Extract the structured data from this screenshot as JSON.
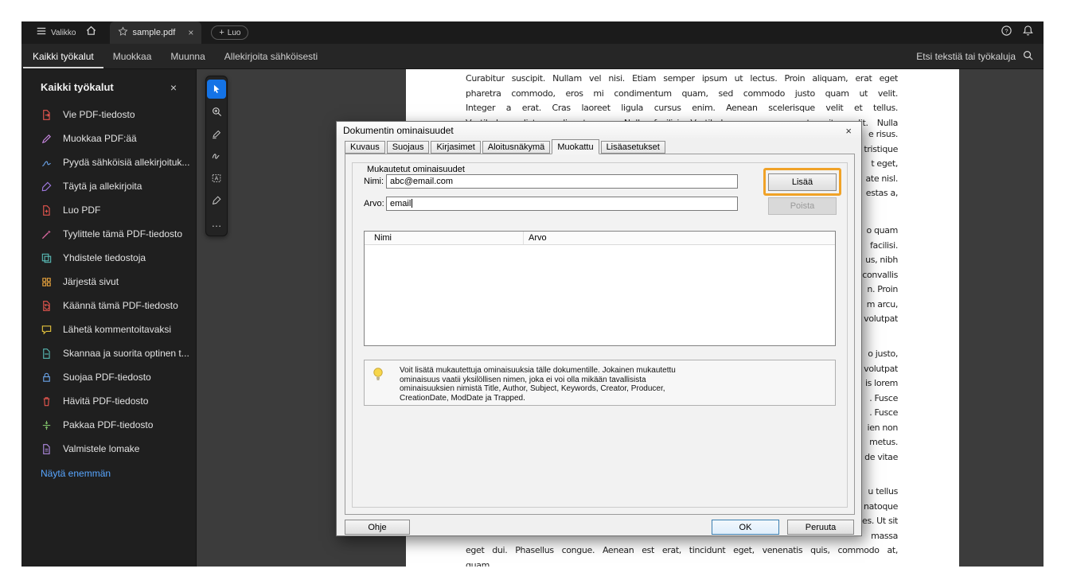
{
  "colors": {
    "accent_blue": "#1473e6",
    "highlight_orange": "#f0a227",
    "link_blue": "#58a6ff"
  },
  "icons": {
    "close": "×",
    "plus": "+",
    "more": "…"
  },
  "topbar": {
    "menu_label": "Valikko",
    "tab_title": "sample.pdf",
    "new_tab_label": "Luo"
  },
  "navbar": {
    "tabs": [
      "Kaikki työkalut",
      "Muokkaa",
      "Muunna",
      "Allekirjoita sähköisesti"
    ],
    "search_label": "Etsi tekstiä tai työkaluja"
  },
  "sidebar": {
    "title": "Kaikki työkalut",
    "show_more_label": "Näytä enemmän",
    "items": [
      "Vie PDF-tiedosto",
      "Muokkaa PDF:ää",
      "Pyydä sähköisiä allekirjoituk...",
      "Täytä ja allekirjoita",
      "Luo PDF",
      "Tyylittele tämä PDF-tiedosto",
      "Yhdistele tiedostoja",
      "Järjestä sivut",
      "Käännä tämä PDF-tiedosto",
      "Lähetä kommentoitavaksi",
      "Skannaa ja suorita optinen t...",
      "Suojaa PDF-tiedosto",
      "Hävitä PDF-tiedosto",
      "Pakkaa PDF-tiedosto",
      "Valmistele lomake"
    ]
  },
  "dialog": {
    "title": "Dokumentin ominaisuudet",
    "tabs": [
      "Kuvaus",
      "Suojaus",
      "Kirjasimet",
      "Aloitusnäkymä",
      "Muokattu",
      "Lisäasetukset"
    ],
    "active_tab": "Muokattu",
    "group_title": "Mukautetut ominaisuudet",
    "name_label": "Nimi:",
    "name_value": "abc@email.com",
    "value_label": "Arvo:",
    "value_value": "email",
    "add_label": "Lisää",
    "remove_label": "Poista",
    "table_headers": [
      "Nimi",
      "Arvo"
    ],
    "info_text": "Voit lisätä mukautettuja ominaisuuksia tälle dokumentille. Jokainen mukautettu ominaisuus vaatii yksilöllisen nimen, joka ei voi olla mikään tavallisista ominaisuuksien nimistä Title, Author, Subject, Keywords, Creator, Producer, CreationDate, ModDate ja Trapped.",
    "help_label": "Ohje",
    "ok_label": "OK",
    "cancel_label": "Peruuta"
  },
  "document": {
    "top_lines": [
      "Curabitur suscipit. Nullam vel nisi. Etiam semper ipsum ut lectus. Proin aliquam, erat eget",
      "pharetra commodo, eros mi condimentum quam, sed commodo justo quam ut velit.",
      "Integer a erat. Cras laoreet ligula cursus enim. Aenean scelerisque velit et tellus.",
      "Vestibulum dictum aliquet sem. Nulla facilisi. Vestibulum accumsan ante vitae elit. Nulla"
    ],
    "fragments_a": [
      "e risus.",
      "tristique",
      "t eget,",
      "ate nisl.",
      "estas a,"
    ],
    "fragments_b": [
      "o quam",
      "facilisi.",
      "us, nibh",
      "convallis",
      "n. Proin",
      "m arcu,",
      "volutpat"
    ],
    "fragments_c": [
      "o justo,",
      "volutpat",
      "is lorem",
      ". Fusce",
      ". Fusce",
      "ien non",
      "metus.",
      "de vitae"
    ],
    "fragments_d": [
      "u tellus",
      "natoque",
      "es. Ut sit",
      "massa"
    ],
    "bottom_line_1": "eget dui. Phasellus congue. Aenean est erat, tincidunt eget, venenatis quis, commodo at,",
    "bottom_line_2": "quam."
  }
}
